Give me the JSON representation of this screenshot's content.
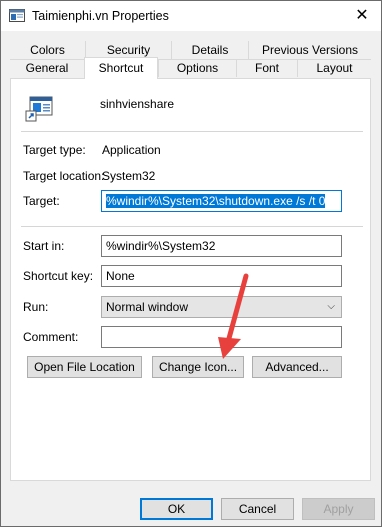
{
  "window": {
    "title": "Taimienphi.vn Properties",
    "close_label": "✕",
    "icon": "shortcut-properties-icon"
  },
  "tabs": {
    "row1": [
      "Colors",
      "Security",
      "Details",
      "Previous Versions"
    ],
    "row2": [
      "General",
      "Shortcut",
      "Options",
      "Font",
      "Layout"
    ],
    "active": "Shortcut"
  },
  "shortcut": {
    "app_icon": "application-shortcut-icon",
    "name": "sinhvienshare",
    "target_type_label": "Target type:",
    "target_type_value": "Application",
    "target_location_label": "Target location:",
    "target_location_value": "System32",
    "target_label": "Target:",
    "target_value": "%windir%\\System32\\shutdown.exe /s /t 0",
    "start_in_label": "Start in:",
    "start_in_value": "%windir%\\System32",
    "shortcut_key_label": "Shortcut key:",
    "shortcut_key_value": "None",
    "run_label": "Run:",
    "run_value": "Normal window",
    "comment_label": "Comment:",
    "comment_value": ""
  },
  "buttons": {
    "open_file_location": "Open File Location",
    "change_icon": "Change Icon...",
    "advanced": "Advanced...",
    "ok": "OK",
    "cancel": "Cancel",
    "apply": "Apply"
  },
  "colors": {
    "accent": "#0078d7",
    "annotation_arrow": "#e8413d"
  }
}
